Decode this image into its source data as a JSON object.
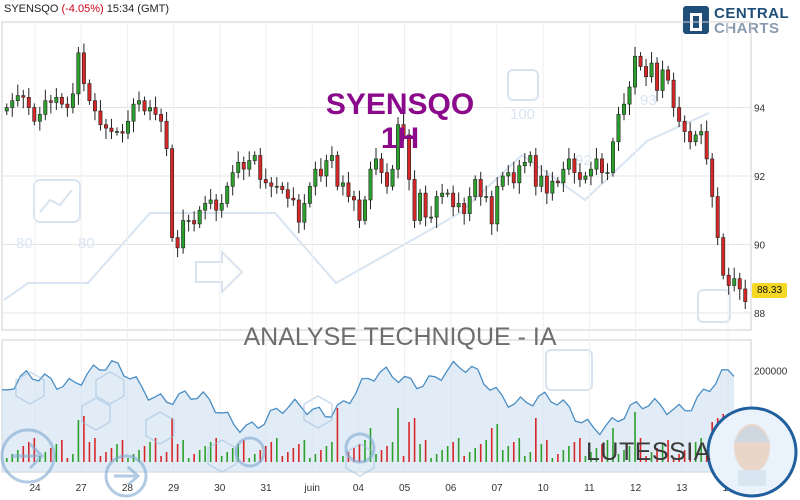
{
  "header": {
    "symbol": "SYENSQO",
    "change": "(-4.05%)",
    "time": "15:34 (GMT)"
  },
  "logo": {
    "line1": "CENTRAL",
    "line2": "CHARTS"
  },
  "overlay": {
    "symbol_big": "SYENSQO",
    "timeframe_big": "1H",
    "analysis_text": "ANALYSE TECHNIQUE - IA",
    "brand": "LUTESSIA"
  },
  "last_price_label": "88.33",
  "colors": {
    "up": "#2ca02c",
    "down": "#d62728",
    "grid": "#e5e5e5",
    "volume_line": "#4a8ec4",
    "volume_fill": "#cfe0f0",
    "title": "#8b0a8b",
    "price_label_bg": "#f5d823"
  },
  "chart_data": [
    {
      "type": "candlestick",
      "title": "",
      "ylim": [
        87.5,
        96.5
      ],
      "y_ticks": [
        "94",
        "92",
        "90",
        "88"
      ],
      "x_ticks": [
        "24",
        "27",
        "28",
        "29",
        "30",
        "31",
        "juin",
        "04",
        "05",
        "06",
        "07",
        "10",
        "11",
        "12",
        "13",
        "14"
      ],
      "closes": [
        94.0,
        94.2,
        94.35,
        94.3,
        94.0,
        93.6,
        93.8,
        94.2,
        94.15,
        94.3,
        94.1,
        94.0,
        94.4,
        95.6,
        94.7,
        94.2,
        93.9,
        93.5,
        93.4,
        93.3,
        93.3,
        93.25,
        93.6,
        94.1,
        94.2,
        93.9,
        94.0,
        93.8,
        93.6,
        92.8,
        90.2,
        89.9,
        90.7,
        90.7,
        90.6,
        91.0,
        91.2,
        91.3,
        91.0,
        91.2,
        91.7,
        92.1,
        92.4,
        92.2,
        92.45,
        92.6,
        91.9,
        91.8,
        91.7,
        91.7,
        91.6,
        91.35,
        91.3,
        90.65,
        91.2,
        91.7,
        92.2,
        92.0,
        92.45,
        92.6,
        91.7,
        91.8,
        91.4,
        91.3,
        90.7,
        91.3,
        92.2,
        92.5,
        92.1,
        91.7,
        92.2,
        93.5,
        93.2,
        91.9,
        90.7,
        91.5,
        90.8,
        90.8,
        91.4,
        91.5,
        91.5,
        91.1,
        91.2,
        90.9,
        91.4,
        91.9,
        91.4,
        91.4,
        90.6,
        91.7,
        92.0,
        92.1,
        91.8,
        92.3,
        92.4,
        92.6,
        91.7,
        92.0,
        91.5,
        91.85,
        91.8,
        92.2,
        92.5,
        92.1,
        91.9,
        92.0,
        92.2,
        92.5,
        92.1,
        92.1,
        93.0,
        93.8,
        94.1,
        94.6,
        95.5,
        95.2,
        94.9,
        95.3,
        94.5,
        95.1,
        94.8,
        94.0,
        93.6,
        93.3,
        93.0,
        93.2,
        93.3,
        92.5,
        91.4,
        90.2,
        89.1,
        88.8,
        89.0,
        88.7,
        88.33
      ],
      "volume_ylim": [
        0,
        260000
      ],
      "volume_tick": "200000"
    }
  ]
}
